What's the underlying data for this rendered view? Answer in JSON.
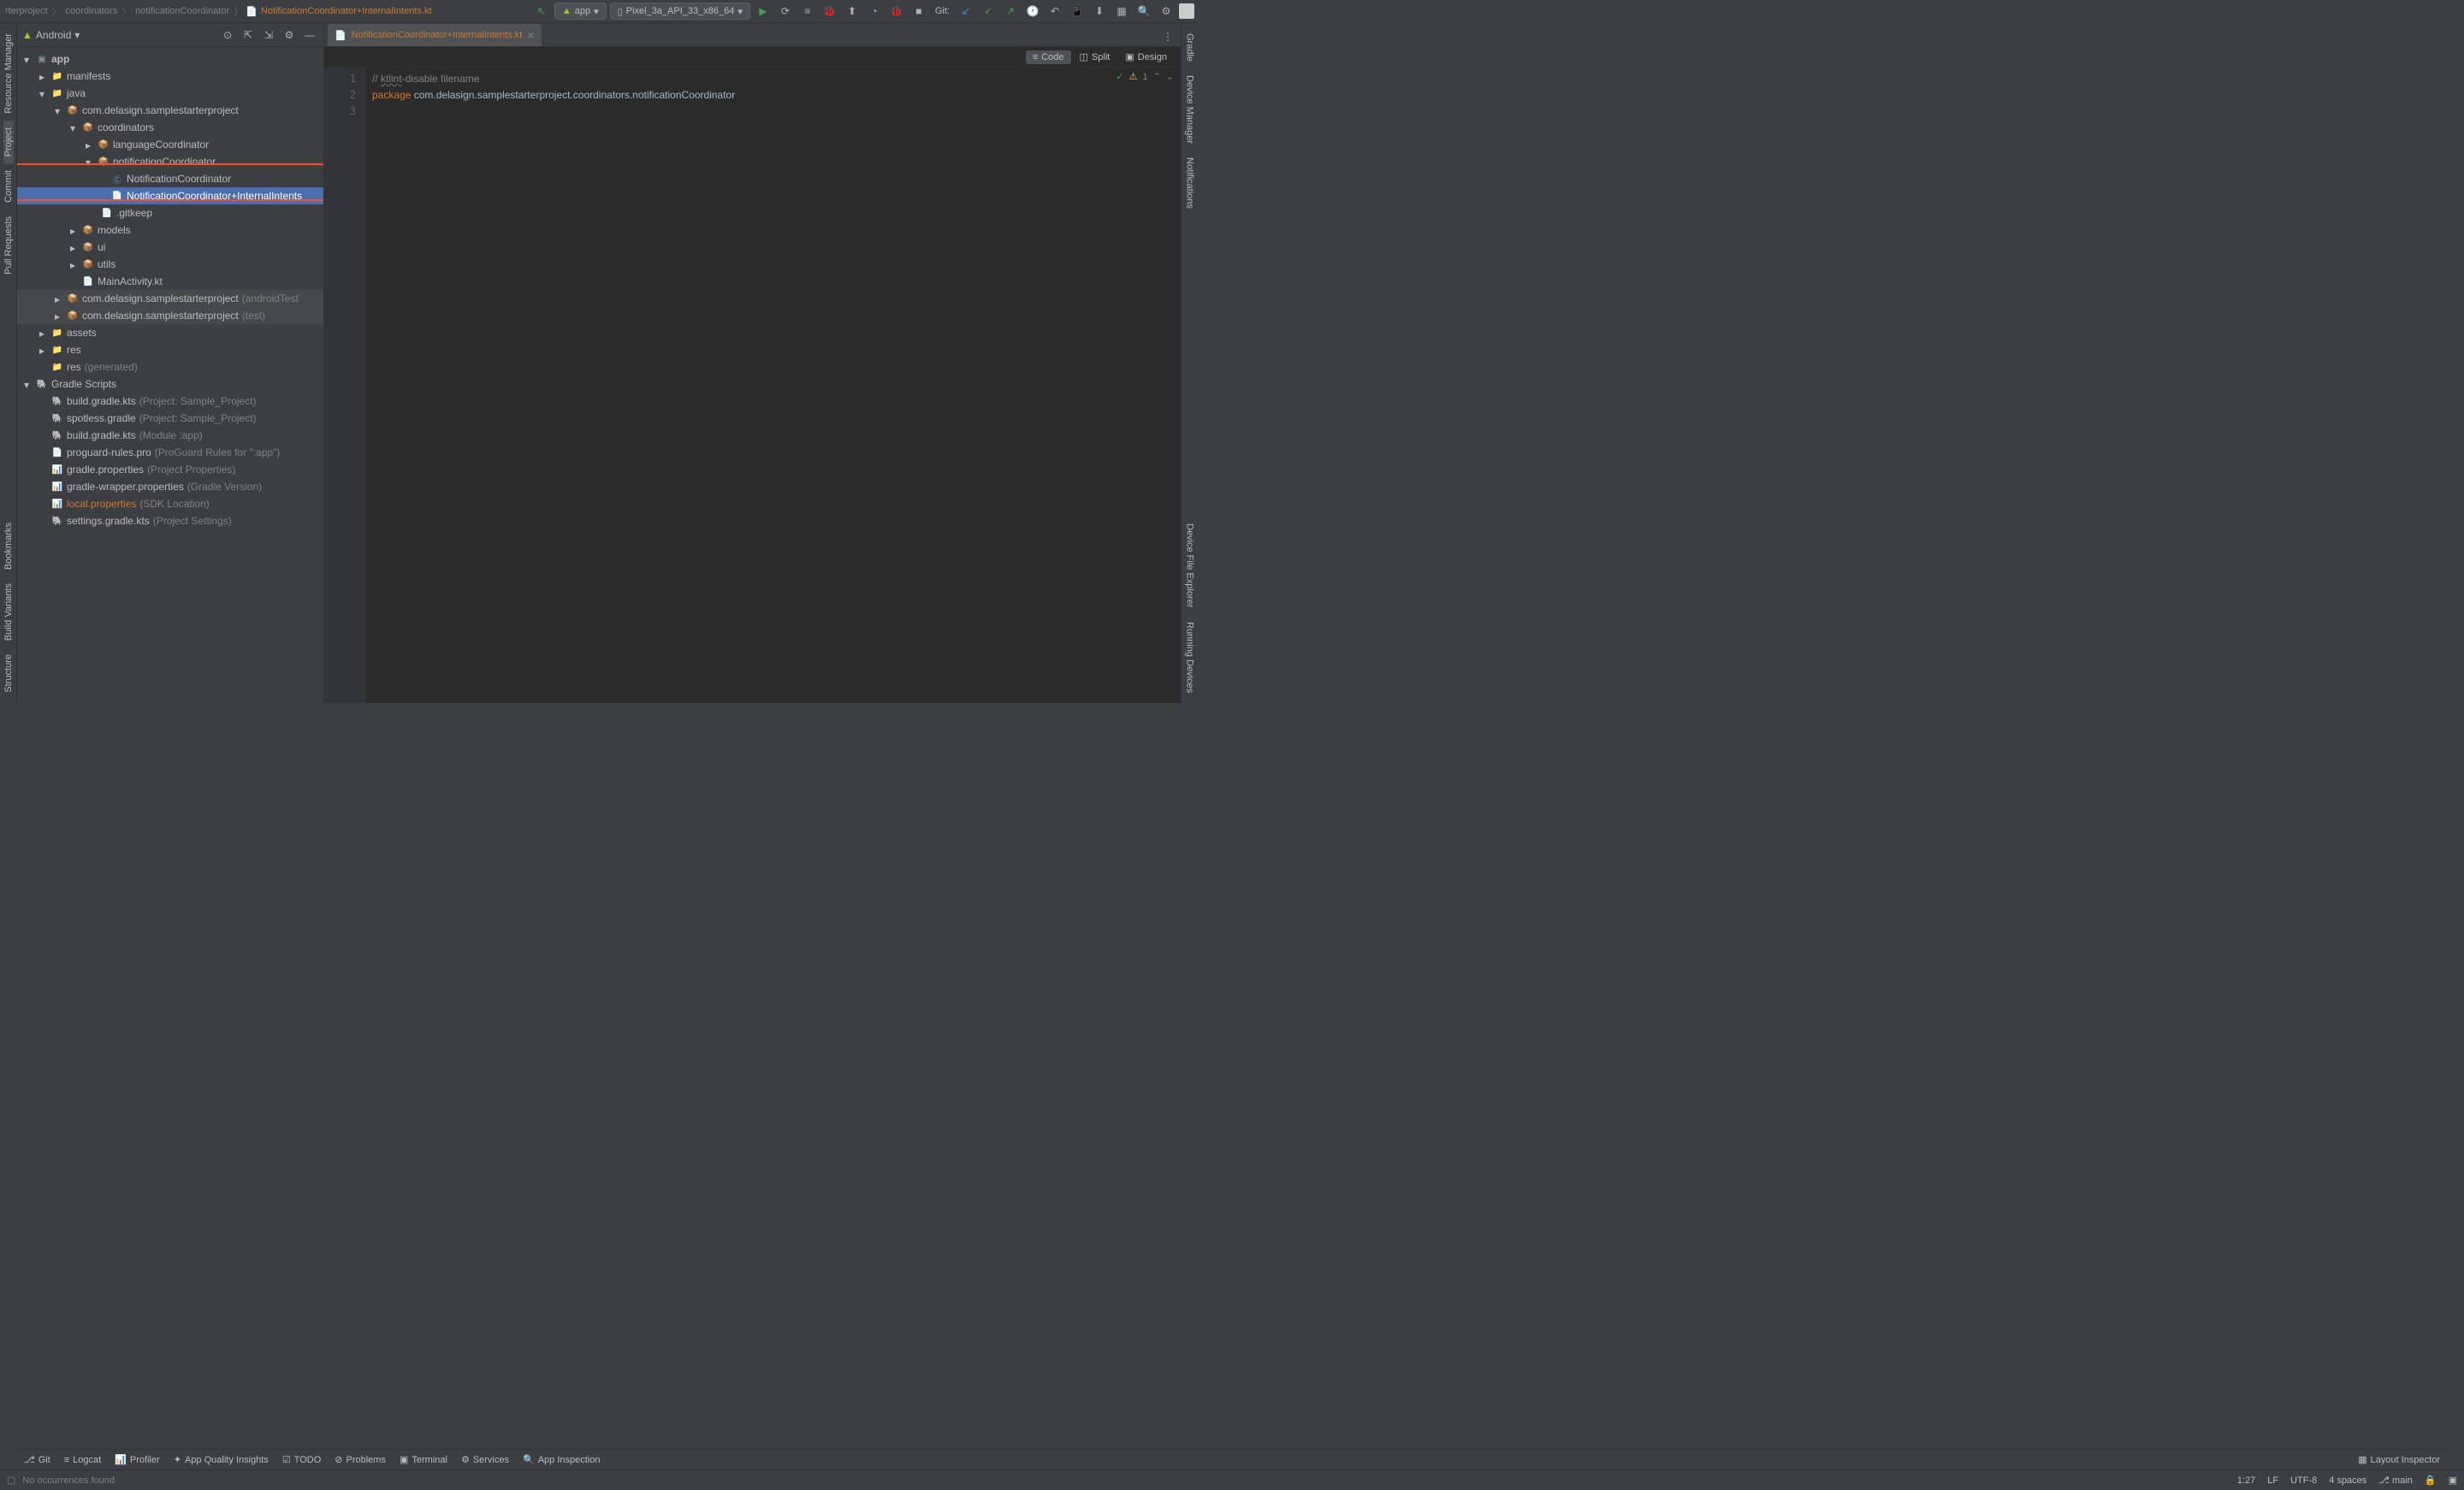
{
  "breadcrumbs": {
    "p0": "rterproject",
    "p1": "coordinators",
    "p2": "notificationCoordinator",
    "p3": "NotificationCoordinator+InternalIntents.kt"
  },
  "toolbar": {
    "config": "app",
    "device": "Pixel_3a_API_33_x86_64",
    "git_label": "Git:"
  },
  "panel": {
    "title": "Android"
  },
  "tree": {
    "app": "app",
    "manifests": "manifests",
    "java": "java",
    "pkg_main": "com.delasign.samplestarterproject",
    "coordinators": "coordinators",
    "languageCoordinator": "languageCoordinator",
    "notificationCoordinator": "notificationCoordinator",
    "notif_class": "NotificationCoordinator",
    "notif_intents": "NotificationCoordinator+InternalIntents",
    "gitkeep": ".gitkeep",
    "models": "models",
    "ui": "ui",
    "utils": "utils",
    "main_activity": "MainActivity.kt",
    "pkg_atest": "com.delasign.samplestarterproject",
    "pkg_atest_hint": "(androidTest",
    "pkg_test": "com.delasign.samplestarterproject",
    "pkg_test_hint": "(test)",
    "assets": "assets",
    "res": "res",
    "res_gen": "res",
    "res_gen_hint": "(generated)",
    "gradle_scripts": "Gradle Scripts",
    "build_project": "build.gradle.kts",
    "build_project_hint": "(Project: Sample_Project)",
    "spotless": "spotless.gradle",
    "spotless_hint": "(Project: Sample_Project)",
    "build_app": "build.gradle.kts",
    "build_app_hint": "(Module :app)",
    "proguard": "proguard-rules.pro",
    "proguard_hint": "(ProGuard Rules for \":app\")",
    "gradle_props": "gradle.properties",
    "gradle_props_hint": "(Project Properties)",
    "wrapper_props": "gradle-wrapper.properties",
    "wrapper_props_hint": "(Gradle Version)",
    "local_props": "local.properties",
    "local_props_hint": "(SDK Location)",
    "settings": "settings.gradle.kts",
    "settings_hint": "(Project Settings)"
  },
  "left_gutter": {
    "resource_mgr": "Resource Manager",
    "project": "Project",
    "commit": "Commit",
    "pull_requests": "Pull Requests",
    "bookmarks": "Bookmarks",
    "build_variants": "Build Variants",
    "structure": "Structure"
  },
  "right_gutter": {
    "gradle": "Gradle",
    "device_mgr": "Device Manager",
    "notifications": "Notifications",
    "device_file": "Device File Explorer",
    "running_devices": "Running Devices"
  },
  "editor": {
    "tab_name": "NotificationCoordinator+InternalIntents.kt",
    "view_code": "Code",
    "view_split": "Split",
    "view_design": "Design",
    "warn_count": "1",
    "line1_a": "// ",
    "line1_b": "ktlint",
    "line1_c": "-disable filename",
    "line2_kw": "package",
    "line2_pkg": " com.delasign.samplestarterproject.coordinators.notificationCoordinator"
  },
  "bottom": {
    "git": "Git",
    "logcat": "Logcat",
    "profiler": "Profiler",
    "quality": "App Quality Insights",
    "todo": "TODO",
    "problems": "Problems",
    "terminal": "Terminal",
    "services": "Services",
    "inspection": "App Inspection",
    "layout_inspector": "Layout Inspector"
  },
  "status": {
    "occurrences": "No occurrences found",
    "pos": "1:27",
    "lf": "LF",
    "encoding": "UTF-8",
    "indent": "4 spaces",
    "branch": "main"
  }
}
